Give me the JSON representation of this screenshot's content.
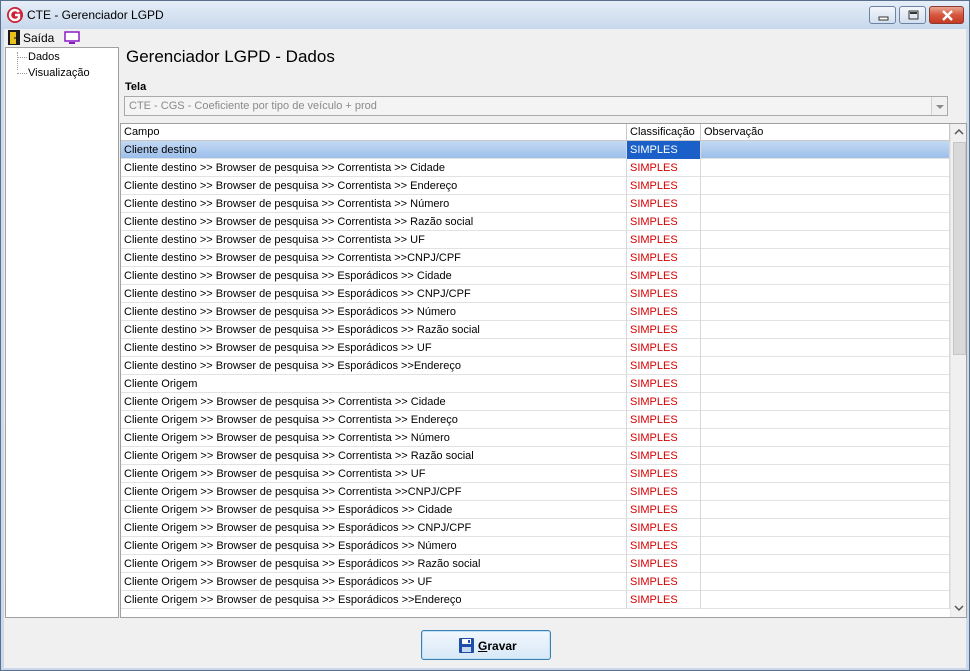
{
  "window": {
    "title": "CTE - Gerenciador LGPD",
    "accent": "#cc2233"
  },
  "menu": {
    "exit_label": "Saída",
    "exit_icon": "door-exit-icon",
    "screen_icon": "monitor-icon"
  },
  "tree": {
    "items": [
      {
        "label": "Dados"
      },
      {
        "label": "Visualização"
      }
    ]
  },
  "main": {
    "title": "Gerenciador LGPD - Dados",
    "tela_label": "Tela",
    "tela_value": "CTE - CGS - Coeficiente por tipo de veículo + prod"
  },
  "grid": {
    "columns": [
      "Campo",
      "Classificação",
      "Observação"
    ],
    "rows": [
      {
        "campo": "Cliente destino",
        "classificacao": "SIMPLES",
        "observacao": "",
        "selected": true
      },
      {
        "campo": "Cliente destino >> Browser de pesquisa >> Correntista >> Cidade",
        "classificacao": "SIMPLES",
        "observacao": ""
      },
      {
        "campo": "Cliente destino >> Browser de pesquisa >> Correntista >> Endereço",
        "classificacao": "SIMPLES",
        "observacao": ""
      },
      {
        "campo": "Cliente destino >> Browser de pesquisa >> Correntista >> Número",
        "classificacao": "SIMPLES",
        "observacao": ""
      },
      {
        "campo": "Cliente destino >> Browser de pesquisa >> Correntista >> Razão social",
        "classificacao": "SIMPLES",
        "observacao": ""
      },
      {
        "campo": "Cliente destino >> Browser de pesquisa >> Correntista >> UF",
        "classificacao": "SIMPLES",
        "observacao": ""
      },
      {
        "campo": "Cliente destino >> Browser de pesquisa >> Correntista >>CNPJ/CPF",
        "classificacao": "SIMPLES",
        "observacao": ""
      },
      {
        "campo": "Cliente destino >> Browser de pesquisa >> Esporádicos >> Cidade",
        "classificacao": "SIMPLES",
        "observacao": ""
      },
      {
        "campo": "Cliente destino >> Browser de pesquisa >> Esporádicos >> CNPJ/CPF",
        "classificacao": "SIMPLES",
        "observacao": ""
      },
      {
        "campo": "Cliente destino >> Browser de pesquisa >> Esporádicos >> Número",
        "classificacao": "SIMPLES",
        "observacao": ""
      },
      {
        "campo": "Cliente destino >> Browser de pesquisa >> Esporádicos >> Razão social",
        "classificacao": "SIMPLES",
        "observacao": ""
      },
      {
        "campo": "Cliente destino >> Browser de pesquisa >> Esporádicos >> UF",
        "classificacao": "SIMPLES",
        "observacao": ""
      },
      {
        "campo": "Cliente destino >> Browser de pesquisa >> Esporádicos >>Endereço",
        "classificacao": "SIMPLES",
        "observacao": ""
      },
      {
        "campo": "Cliente Origem",
        "classificacao": "SIMPLES",
        "observacao": ""
      },
      {
        "campo": "Cliente Origem >> Browser de pesquisa >> Correntista >> Cidade",
        "classificacao": "SIMPLES",
        "observacao": ""
      },
      {
        "campo": "Cliente Origem >> Browser de pesquisa >> Correntista >> Endereço",
        "classificacao": "SIMPLES",
        "observacao": ""
      },
      {
        "campo": "Cliente Origem >> Browser de pesquisa >> Correntista >> Número",
        "classificacao": "SIMPLES",
        "observacao": ""
      },
      {
        "campo": "Cliente Origem >> Browser de pesquisa >> Correntista >> Razão social",
        "classificacao": "SIMPLES",
        "observacao": ""
      },
      {
        "campo": "Cliente Origem >> Browser de pesquisa >> Correntista >> UF",
        "classificacao": "SIMPLES",
        "observacao": ""
      },
      {
        "campo": "Cliente Origem >> Browser de pesquisa >> Correntista >>CNPJ/CPF",
        "classificacao": "SIMPLES",
        "observacao": ""
      },
      {
        "campo": "Cliente Origem >> Browser de pesquisa >> Esporádicos >> Cidade",
        "classificacao": "SIMPLES",
        "observacao": ""
      },
      {
        "campo": "Cliente Origem >> Browser de pesquisa >> Esporádicos >> CNPJ/CPF",
        "classificacao": "SIMPLES",
        "observacao": ""
      },
      {
        "campo": "Cliente Origem >> Browser de pesquisa >> Esporádicos >> Número",
        "classificacao": "SIMPLES",
        "observacao": ""
      },
      {
        "campo": "Cliente Origem >> Browser de pesquisa >> Esporádicos >> Razão social",
        "classificacao": "SIMPLES",
        "observacao": ""
      },
      {
        "campo": "Cliente Origem >> Browser de pesquisa >> Esporádicos >> UF",
        "classificacao": "SIMPLES",
        "observacao": ""
      },
      {
        "campo": "Cliente Origem >> Browser de pesquisa >> Esporádicos >>Endereço",
        "classificacao": "SIMPLES",
        "observacao": ""
      }
    ],
    "classification_color": "#d40000",
    "selected_color": "#1b5fc8"
  },
  "footer": {
    "save_label_first": "G",
    "save_label_rest": "ravar",
    "save_icon": "floppy-disk-icon"
  }
}
